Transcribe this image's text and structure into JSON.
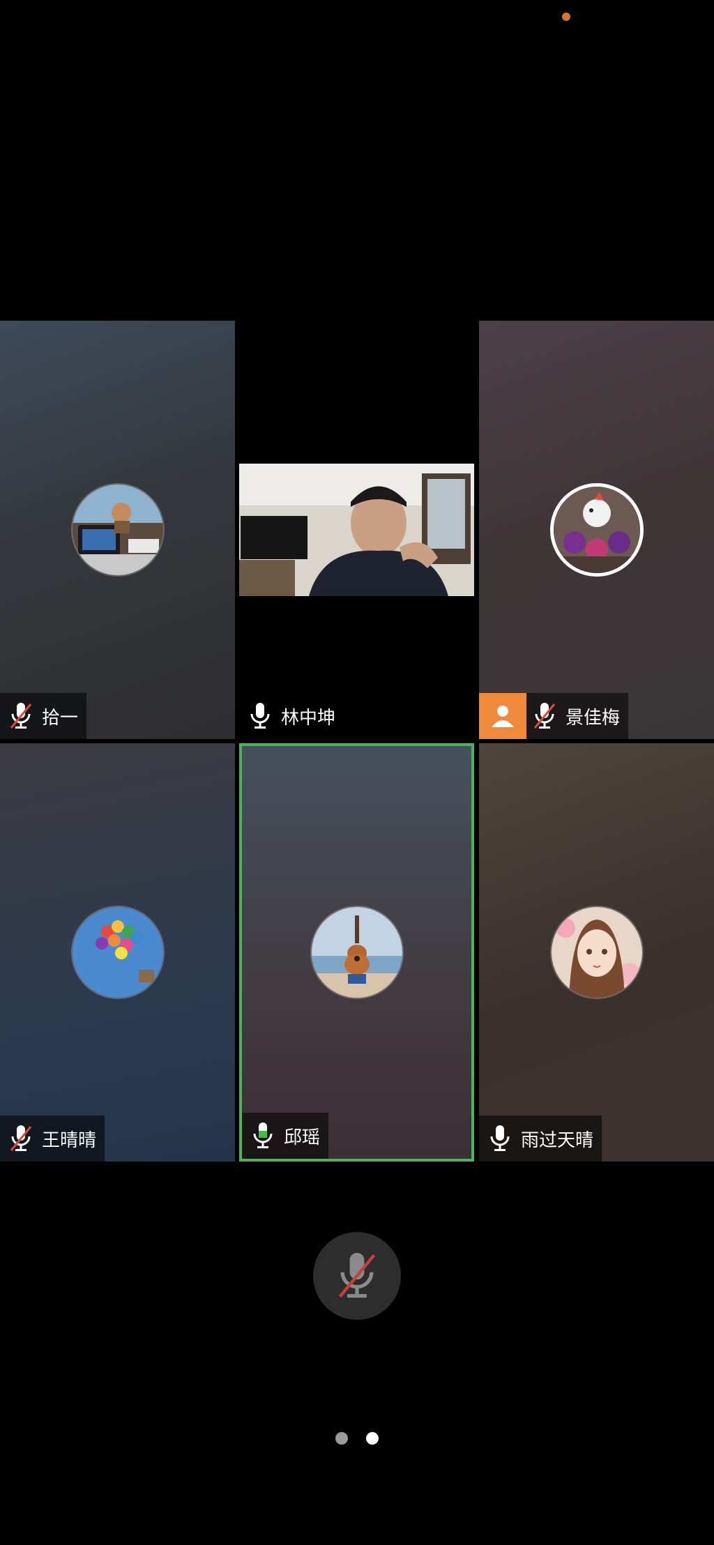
{
  "colors": {
    "status_dot": "#d9762a",
    "active_border": "#4cb35a",
    "mic_on_green": "#3fbf4a",
    "mute_slash": "#e04a3a",
    "person_badge": "#f08a3a",
    "pager_active": "#ffffff",
    "pager_inactive": "#9a9a9a"
  },
  "participants": [
    {
      "name": "拾一",
      "mic": "muted",
      "avatar": "car-dashboard-photo"
    },
    {
      "name": "林中坤",
      "mic": "on",
      "avatar": "live-camera-video"
    },
    {
      "name": "景佳梅",
      "mic": "muted",
      "avatar": "plush-toys-photo",
      "badge": "person-icon"
    },
    {
      "name": "王晴晴",
      "mic": "muted",
      "avatar": "balloon-house-photo"
    },
    {
      "name": "邱瑶",
      "mic": "speaking",
      "avatar": "ukulele-photo",
      "active": true
    },
    {
      "name": "雨过天晴",
      "mic": "on",
      "avatar": "anime-girl-photo"
    }
  ],
  "controls": {
    "mute_button_icon": "mic-muted-icon"
  },
  "pager": {
    "count": 2,
    "active_index": 1
  }
}
